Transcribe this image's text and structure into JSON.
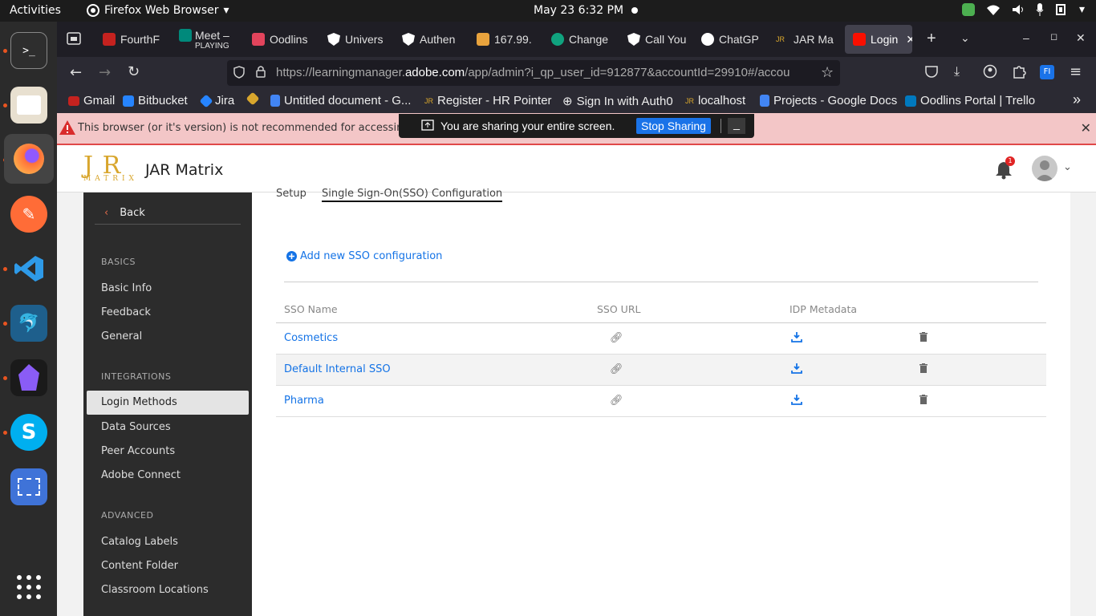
{
  "topbar": {
    "activities": "Activities",
    "app_name": "Firefox Web Browser",
    "clock": "May 23  6:32 PM"
  },
  "tabs": [
    {
      "label": "FourthF",
      "color": "#c5221f"
    },
    {
      "label": "Meet –",
      "sub": "PLAYING",
      "color": "#00897b"
    },
    {
      "label": "Oodlins",
      "color": "#e2445c"
    },
    {
      "label": "Univers",
      "color": "#ffffff"
    },
    {
      "label": "Authen",
      "color": "#ffffff"
    },
    {
      "label": "167.99.",
      "color": "#e8a33d"
    },
    {
      "label": "Change",
      "color": "#10a37f"
    },
    {
      "label": "Call You",
      "color": "#ffffff"
    },
    {
      "label": "ChatGP",
      "color": "#ffffff"
    },
    {
      "label": "JAR Ma",
      "color": "#d8a62d"
    },
    {
      "label": "Login",
      "color": "#fa0f00"
    }
  ],
  "url": {
    "prefix": "https://learningmanager.",
    "domain": "adobe.com",
    "path": "/app/admin?i_qp_user_id=912877&accountId=29910#/accou"
  },
  "bookmarks": [
    {
      "label": "Gmail"
    },
    {
      "label": "Bitbucket"
    },
    {
      "label": "Jira"
    },
    {
      "label": ""
    },
    {
      "label": "Untitled document - G..."
    },
    {
      "label": "Register - HR Pointer"
    },
    {
      "label": "Sign In with Auth0"
    },
    {
      "label": "localhost"
    },
    {
      "label": "Projects - Google Docs"
    },
    {
      "label": "Oodlins Portal | Trello"
    }
  ],
  "warning": {
    "text": "This browser (or it's version) is not recommended for accessing Adobe"
  },
  "sharing": {
    "message": "You are sharing your entire screen.",
    "stop": "Stop Sharing",
    "minimize": "_"
  },
  "app": {
    "logo": "J R",
    "logo_sub": "MATRIX",
    "brand": "JAR Matrix",
    "notif_count": "1"
  },
  "sidebar": {
    "back": "Back",
    "sections": [
      {
        "title": "BASICS",
        "items": [
          "Basic Info",
          "Feedback",
          "General"
        ]
      },
      {
        "title": "INTEGRATIONS",
        "items": [
          "Login Methods",
          "Data Sources",
          "Peer Accounts",
          "Adobe Connect"
        ]
      },
      {
        "title": "ADVANCED",
        "items": [
          "Catalog Labels",
          "Content Folder",
          "Classroom Locations"
        ]
      }
    ],
    "active": "Login Methods"
  },
  "subtabs": [
    "Setup",
    "Single Sign-On(SSO) Configuration"
  ],
  "add_sso": "Add new SSO configuration",
  "table": {
    "headers": [
      "SSO Name",
      "SSO URL",
      "IDP Metadata",
      ""
    ],
    "rows": [
      {
        "name": "Cosmetics"
      },
      {
        "name": "Default Internal SSO"
      },
      {
        "name": "Pharma"
      }
    ]
  },
  "colors": {
    "accent": "#1473e6",
    "logo": "#d8a62d",
    "warning_bg": "#f3c6c7"
  }
}
